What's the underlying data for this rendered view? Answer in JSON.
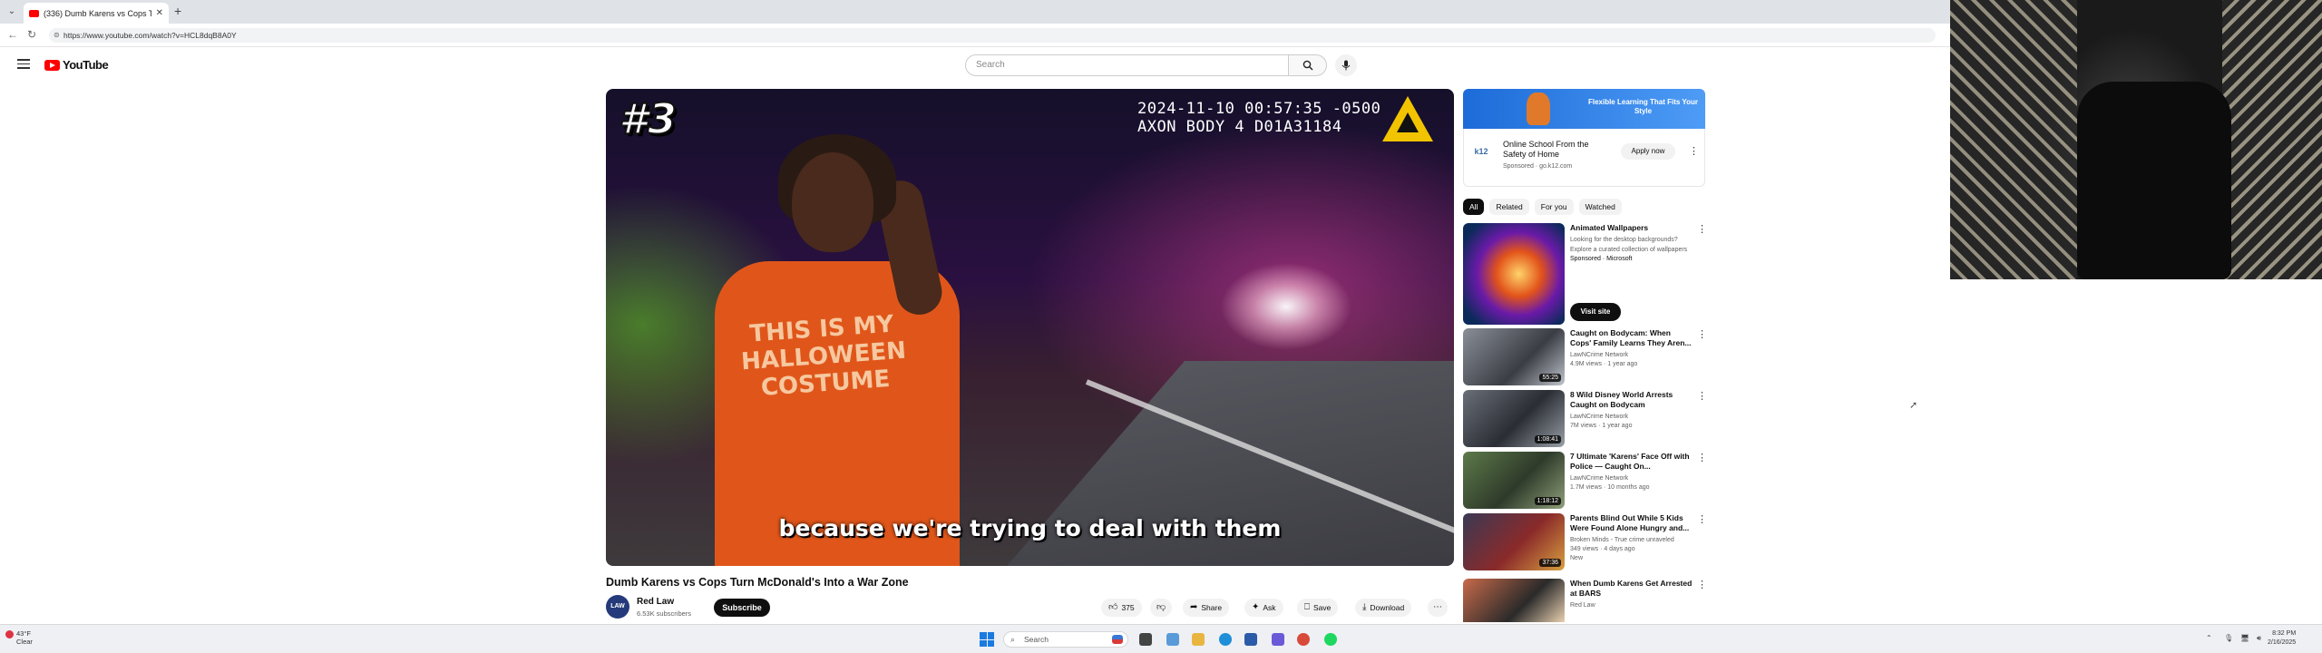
{
  "browser": {
    "tab_title": "(336) Dumb Karens vs Cops T...",
    "url": "https://www.youtube.com/watch?v=HCL8dqB8A0Y"
  },
  "youtube": {
    "logo_text": "YouTube",
    "search_placeholder": "Search"
  },
  "player": {
    "rank_label": "#3",
    "timestamp_line1": "2024-11-10 00:57:35 -0500",
    "timestamp_line2": "AXON BODY 4 D01A31184",
    "shirt_text": "THIS IS MY HALLOWEEN COSTUME",
    "caption": "because we're trying to deal with them"
  },
  "video": {
    "title": "Dumb Karens vs Cops Turn McDonald's Into a War Zone",
    "channel": "Red Law",
    "channel_avatar_text": "LAW",
    "subscribers": "6.53K subscribers",
    "subscribe_label": "Subscribe",
    "likes": "375",
    "share_label": "Share",
    "ask_label": "Ask",
    "save_label": "Save",
    "download_label": "Download"
  },
  "ad": {
    "banner_text": "Flexible Learning That Fits Your Style",
    "logo_text": "k12",
    "title": "Online School From the Safety of Home",
    "sponsored": "Sponsored · go.k12.com",
    "apply_label": "Apply now"
  },
  "chips": [
    "All",
    "Related",
    "For you",
    "Watched"
  ],
  "recommendations": [
    {
      "title": "Animated Wallpapers",
      "channel": "Looking for the desktop backgrounds? Explore a curated collection of wallpapers",
      "views": "Sponsored · Microsoft",
      "date": "",
      "duration": "",
      "visit_label": "Visit site"
    },
    {
      "title": "Caught on Bodycam: When Cops' Family Learns They Aren...",
      "channel": "LawNCrime Network",
      "views": "4.9M views · 1 year ago",
      "duration": "55:25"
    },
    {
      "title": "8 Wild Disney World Arrests Caught on Bodycam",
      "channel": "LawNCrime Network",
      "views": "7M views · 1 year ago",
      "duration": "1:08:41"
    },
    {
      "title": "7 Ultimate 'Karens' Face Off with Police — Caught On...",
      "channel": "LawNCrime Network",
      "views": "1.7M views · 10 months ago",
      "duration": "1:18:12"
    },
    {
      "title": "Parents Blind Out While 5 Kids Were Found Alone Hungry and...",
      "channel": "Broken Minds - True crime unraveled",
      "views": "349 views · 4 days ago",
      "badge": "New",
      "duration": "37:36"
    },
    {
      "title": "When Dumb Karens Get Arrested at BARS",
      "channel": "Red Law",
      "views": "",
      "duration": ""
    }
  ],
  "taskbar": {
    "weather_temp": "43°F",
    "weather_desc": "Clear",
    "search_label": "Search",
    "time": "8:32 PM",
    "date": "2/16/2025"
  },
  "colors": {
    "yt_red": "#ff0000",
    "shirt_orange": "#e0561a",
    "axon_yellow": "#f2c400",
    "dark": "#0f0f0f"
  }
}
